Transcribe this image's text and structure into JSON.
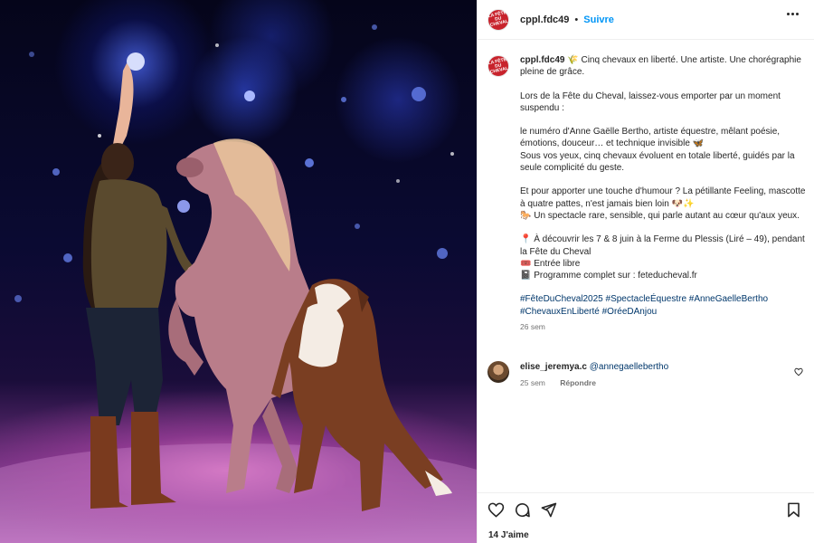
{
  "post": {
    "author": "cppl.fdc49",
    "follow_label": "Suivre",
    "separator": "•",
    "avatar_text": "LA FÊTE DU CHEVAL",
    "caption": {
      "username": "cppl.fdc49",
      "line1": "🌾 Cinq chevaux en liberté. Une artiste. Une chorégraphie pleine de grâce.",
      "para2": "Lors de la Fête du Cheval, laissez-vous emporter par un moment suspendu :",
      "para3_a": "le numéro d'Anne Gaëlle Bertho, artiste équestre, mêlant poésie, émotions, douceur… et technique invisible 🦋",
      "para3_b": "Sous vos yeux, cinq chevaux évoluent en totale liberté, guidés par la seule complicité du geste.",
      "para4_a": "Et pour apporter une touche d'humour ? La pétillante Feeling, mascotte à quatre pattes, n'est jamais bien loin 🐶✨",
      "para4_b": "🐎 Un spectacle rare, sensible, qui parle autant au cœur qu'aux yeux.",
      "para5_a": "📍 À découvrir les 7 & 8 juin à la Ferme du Plessis (Liré – 49), pendant la Fête du Cheval",
      "para5_b": "🎟️ Entrée libre",
      "para5_c": "📓 Programme complet sur : feteducheval.fr",
      "hashtags": "#FêteDuCheval2025 #SpectacleÉquestre #AnneGaelleBertho #ChevauxEnLiberté #OréeDAnjou",
      "time": "26 sem"
    },
    "comment": {
      "username": "elise_jeremya.c",
      "mention": "@annegaellebertho",
      "time": "25 sem",
      "reply_label": "Répondre"
    },
    "likes": "14 J'aime"
  },
  "icons": {
    "like": "heart-icon",
    "comment": "comment-icon",
    "share": "send-icon",
    "save": "bookmark-icon",
    "more": "more-icon"
  },
  "colors": {
    "link": "#0095f6",
    "hashtag": "#00376b",
    "muted": "#737373",
    "brand": "#c8232c"
  }
}
